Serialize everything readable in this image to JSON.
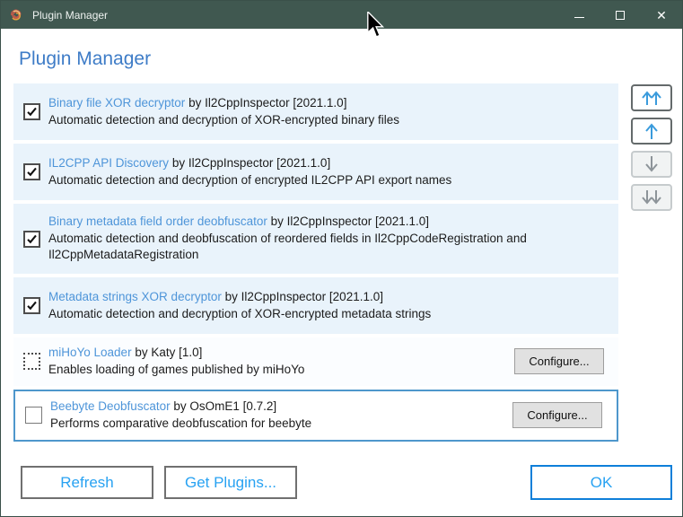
{
  "window": {
    "title": "Plugin Manager"
  },
  "heading": "Plugin Manager",
  "plugins": [
    {
      "name": "Binary file XOR decryptor",
      "meta": "by Il2CppInspector [2021.1.0]",
      "description": "Automatic detection and decryption of XOR-encrypted binary files",
      "state": "checked"
    },
    {
      "name": "IL2CPP API Discovery",
      "meta": "by Il2CppInspector [2021.1.0]",
      "description": "Automatic detection and decryption of encrypted IL2CPP API export names",
      "state": "checked"
    },
    {
      "name": "Binary metadata field order deobfuscator",
      "meta": "by Il2CppInspector [2021.1.0]",
      "description": "Automatic detection and deobfuscation of reordered fields in Il2CppCodeRegistration and Il2CppMetadataRegistration",
      "state": "checked"
    },
    {
      "name": "Metadata strings XOR decryptor",
      "meta": "by Il2CppInspector [2021.1.0]",
      "description": "Automatic detection and decryption of XOR-encrypted metadata strings",
      "state": "checked"
    },
    {
      "name": "miHoYo Loader",
      "meta": "by Katy [1.0]",
      "description": "Enables loading of games published by miHoYo",
      "state": "indeterminate",
      "configure": "Configure..."
    },
    {
      "name": "Beebyte Deobfuscator",
      "meta": "by OsOmE1 [0.7.2]",
      "description": "Performs comparative deobfuscation for beebyte",
      "state": "unchecked",
      "configure": "Configure...",
      "selected": true
    }
  ],
  "reorder_buttons": [
    {
      "icon": "move-to-top-icon",
      "enabled": true
    },
    {
      "icon": "move-up-icon",
      "enabled": true
    },
    {
      "icon": "move-down-icon",
      "enabled": false
    },
    {
      "icon": "move-to-bottom-icon",
      "enabled": false
    }
  ],
  "titlebar_icons": [
    "app-scribble-icon",
    "minimize-icon",
    "maximize-icon",
    "close-icon"
  ],
  "footer": {
    "refresh": "Refresh",
    "get_plugins": "Get Plugins...",
    "ok": "OK"
  },
  "colors": {
    "titlebar": "#405850",
    "heading": "#3e7cc7",
    "plugin_link": "#4e95d9",
    "row_bg": "#e9f3fb",
    "selected_border": "#4e97cc",
    "accent_blue": "#28a2f2",
    "ok_border": "#0e7fd9",
    "arrow_blue": "#3a9bdc"
  }
}
